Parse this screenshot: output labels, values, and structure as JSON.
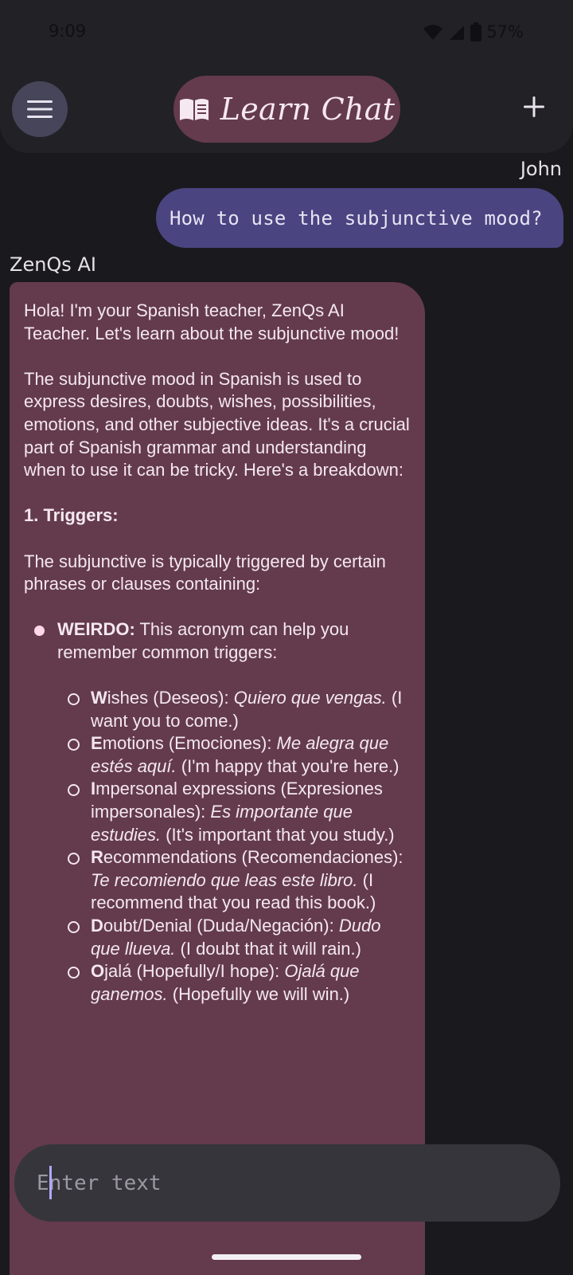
{
  "status_bar": {
    "time": "9:09",
    "battery": "57%"
  },
  "app_bar": {
    "title": "Learn Chat",
    "icons": {
      "menu": "hamburger-menu-icon",
      "book": "open-book-icon",
      "add": "plus-icon"
    }
  },
  "chat": {
    "user_name": "John",
    "user_message": "How to use the subjunctive mood?",
    "ai_name": "ZenQs AI",
    "ai_intro": "Hola! I'm your Spanish teacher, ZenQs AI Teacher. Let's learn about the subjunctive mood!",
    "ai_para2": "The subjunctive mood in Spanish is used to express desires, doubts, wishes, possibilities, emotions, and other subjective ideas. It's a crucial part of Spanish grammar and understanding when to use it can be tricky.  Here's a breakdown:",
    "section_heading": "1. Triggers:",
    "trigger_intro": "The subjunctive is typically triggered by certain phrases or clauses containing:",
    "bullet_term": "WEIRDO:",
    "bullet_text": " This acronym can help you remember common triggers:",
    "sub_items": [
      {
        "letter": "W",
        "rest": "ishes (Deseos): ",
        "example": "Quiero que vengas.",
        "translation": " (I want you to come.)"
      },
      {
        "letter": "E",
        "rest": "motions (Emociones): ",
        "example": "Me alegra que estés aquí.",
        "translation": " (I'm happy that you're here.)"
      },
      {
        "letter": "I",
        "rest": "mpersonal expressions (Expresiones impersonales): ",
        "example": "Es importante que estudies.",
        "translation": " (It's important that you study.)"
      },
      {
        "letter": "R",
        "rest": "ecommendations (Recomendaciones): ",
        "example": "Te recomiendo que leas este libro.",
        "translation": " (I recommend that you read this book.)"
      },
      {
        "letter": "D",
        "rest": "oubt/Denial (Duda/Negación): ",
        "example": "Dudo que llueva.",
        "translation": " (I doubt that it will rain.)"
      },
      {
        "letter": "O",
        "rest": "jalá (Hopefully/I hope): ",
        "example": "Ojalá que ganemos.",
        "translation": " (Hopefully we will win.)"
      }
    ]
  },
  "input": {
    "placeholder": "Enter text",
    "value": ""
  },
  "colors": {
    "background": "#1a191e",
    "app_bar": "#222126",
    "title_pill": "#643b4c",
    "user_bubble": "#4a4480",
    "ai_bubble": "#643b4c",
    "input": "#36353b"
  }
}
